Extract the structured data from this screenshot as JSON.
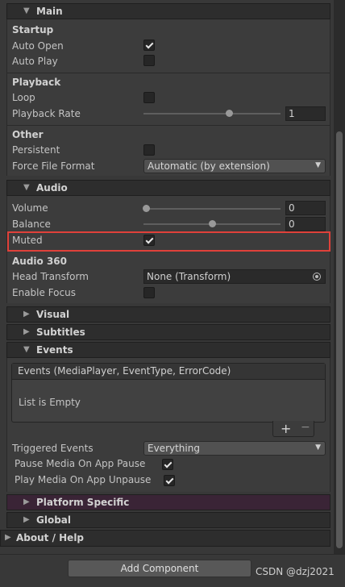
{
  "main": {
    "title": "Main",
    "startup_header": "Startup",
    "auto_open_label": "Auto Open",
    "auto_play_label": "Auto Play",
    "auto_open_checked": true,
    "auto_play_checked": false,
    "playback_header": "Playback",
    "loop_label": "Loop",
    "loop_checked": false,
    "playback_rate_label": "Playback Rate",
    "playback_rate_value": "1",
    "other_header": "Other",
    "persistent_label": "Persistent",
    "persistent_checked": false,
    "force_file_format_label": "Force File Format",
    "force_file_format_value": "Automatic (by extension)"
  },
  "audio": {
    "title": "Audio",
    "volume_label": "Volume",
    "volume_value": "0",
    "balance_label": "Balance",
    "balance_value": "0",
    "muted_label": "Muted",
    "muted_checked": true,
    "audio360_header": "Audio 360",
    "head_transform_label": "Head Transform",
    "head_transform_value": "None (Transform)",
    "enable_focus_label": "Enable Focus",
    "enable_focus_checked": false
  },
  "collapsed": {
    "visual": "Visual",
    "subtitles": "Subtitles"
  },
  "events": {
    "title": "Events",
    "list_header": "Events (MediaPlayer, EventType, ErrorCode)",
    "list_empty": "List is Empty",
    "add_symbol": "+",
    "remove_symbol": "−",
    "triggered_events_label": "Triggered Events",
    "triggered_events_value": "Everything",
    "pause_on_app_pause_label": "Pause Media On App Pause",
    "pause_on_app_pause_checked": true,
    "play_on_app_unpause_label": "Play Media On App Unpause",
    "play_on_app_unpause_checked": true
  },
  "platform_specific": "Platform Specific",
  "global": "Global",
  "about_help": "About / Help",
  "add_component": "Add Component",
  "watermark": "CSDN @dzj2021",
  "icons": {
    "foldout_open": "▼",
    "foldout_closed": "▶",
    "dropdown_arrow": "▼"
  },
  "colors": {
    "highlight_border": "#e0413a",
    "background": "#383838",
    "platform_header": "#3a2436"
  }
}
